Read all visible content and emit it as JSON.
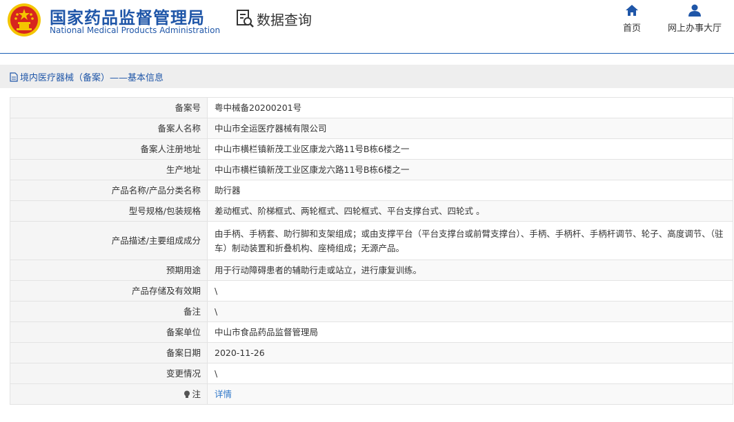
{
  "header": {
    "org_name_cn": "国家药品监督管理局",
    "org_name_en": "National Medical Products Administration",
    "query_title": "数据查询",
    "nav": {
      "home": "首页",
      "online_hall": "网上办事大厅"
    }
  },
  "section": {
    "title": "境内医疗器械（备案）——基本信息"
  },
  "colors": {
    "brand_blue": "#1f56a8",
    "link_blue": "#2f77c9",
    "emblem_red": "#d7261e",
    "emblem_gold": "#f4c500"
  },
  "record": {
    "rows": [
      {
        "label": "备案号",
        "value": "粤中械备20200201号"
      },
      {
        "label": "备案人名称",
        "value": "中山市全运医疗器械有限公司"
      },
      {
        "label": "备案人注册地址",
        "value": "中山市横栏镇新茂工业区康龙六路11号B栋6楼之一"
      },
      {
        "label": "生产地址",
        "value": "中山市横栏镇新茂工业区康龙六路11号B栋6楼之一"
      },
      {
        "label": "产品名称/产品分类名称",
        "value": "助行器"
      },
      {
        "label": "型号规格/包装规格",
        "value": "差动框式、阶梯框式、两轮框式、四轮框式、平台支撑台式、四轮式 。"
      },
      {
        "label": "产品描述/主要组成成分",
        "value": "由手柄、手柄套、助行脚和支架组成；或由支撑平台（平台支撑台或前臂支撑台）、手柄、手柄杆、手柄杆调节、轮子、高度调节、（驻车）制动装置和折叠机构、座椅组成；无源产品。"
      },
      {
        "label": "预期用途",
        "value": "用于行动障碍患者的辅助行走或站立，进行康复训练。"
      },
      {
        "label": "产品存储及有效期",
        "value": "\\"
      },
      {
        "label": "备注",
        "value": "\\"
      },
      {
        "label": "备案单位",
        "value": "中山市食品药品监督管理局"
      },
      {
        "label": "备案日期",
        "value": "2020-11-26"
      },
      {
        "label": "变更情况",
        "value": "\\"
      }
    ],
    "note": {
      "label": "注",
      "link": "详情"
    }
  }
}
